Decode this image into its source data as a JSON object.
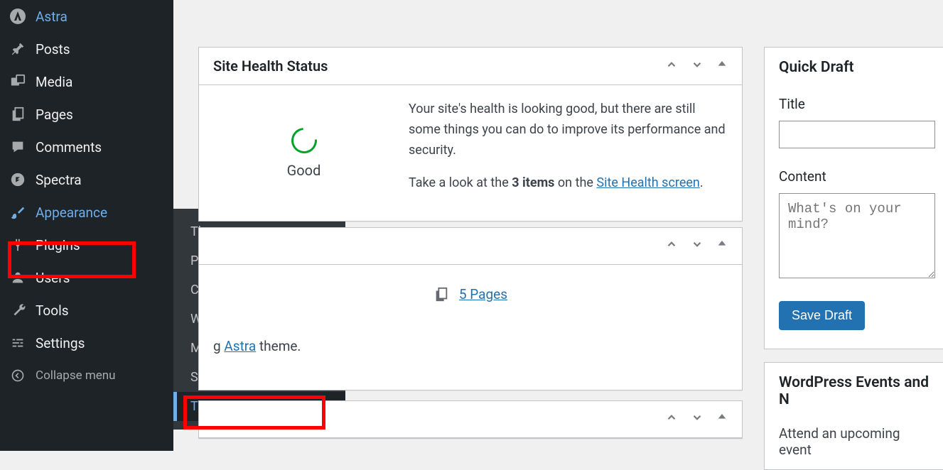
{
  "sidebar": {
    "items": [
      {
        "label": "Astra"
      },
      {
        "label": "Posts"
      },
      {
        "label": "Media"
      },
      {
        "label": "Pages"
      },
      {
        "label": "Comments"
      },
      {
        "label": "Spectra"
      },
      {
        "label": "Appearance"
      },
      {
        "label": "Plugins"
      },
      {
        "label": "Users"
      },
      {
        "label": "Tools"
      },
      {
        "label": "Settings"
      }
    ],
    "collapse": "Collapse menu"
  },
  "submenu": {
    "items": [
      {
        "label": "Themes"
      },
      {
        "label": "Patterns"
      },
      {
        "label": "Customize"
      },
      {
        "label": "Widgets"
      },
      {
        "label": "Menus"
      },
      {
        "label": "Starter Templates"
      },
      {
        "label": "Theme File Editor"
      }
    ]
  },
  "health": {
    "title": "Site Health Status",
    "status": "Good",
    "p1": "Your site's health is looking good, but there are still some things you can do to improve its performance and security.",
    "p2_pre": "Take a look at the ",
    "p2_bold": "3 items",
    "p2_mid": " on the ",
    "p2_link": "Site Health screen",
    "p2_post": "."
  },
  "glance": {
    "pages_link": "5 Pages",
    "theme_pre": "g ",
    "theme_link": "Astra",
    "theme_post": " theme."
  },
  "quick_draft": {
    "title": "Quick Draft",
    "title_label": "Title",
    "content_label": "Content",
    "content_placeholder": "What's on your mind?",
    "save": "Save Draft"
  },
  "events": {
    "title": "WordPress Events and N",
    "text": "Attend an upcoming event"
  }
}
